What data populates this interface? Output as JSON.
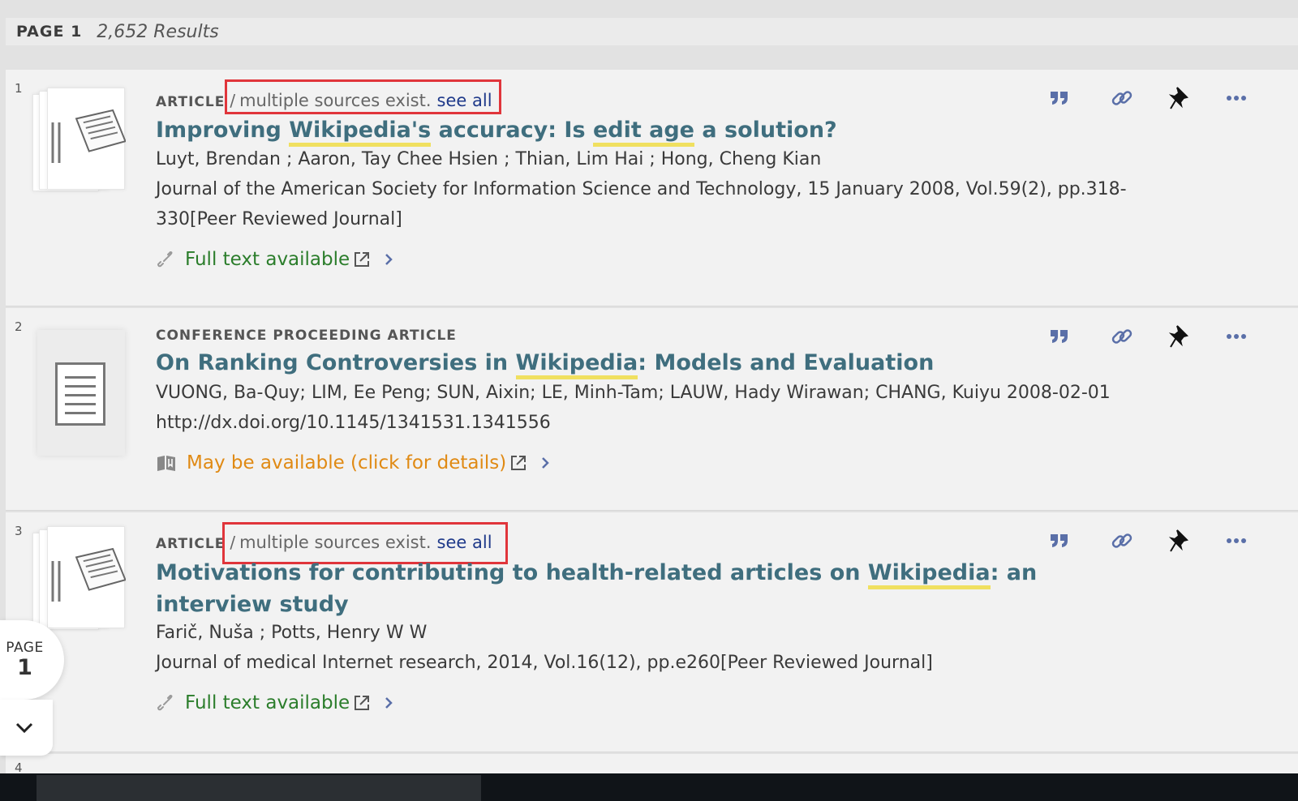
{
  "header": {
    "page_label": "PAGE 1",
    "results_count": "2,652 Results"
  },
  "results": [
    {
      "number": "1",
      "type": "ARTICLE",
      "multiple_sources": "multiple sources exist.",
      "see_all": "see all",
      "title": [
        "Improving ",
        "Wikipedia's",
        " accuracy: Is ",
        "edit age",
        " a solution?"
      ],
      "authors": "Luyt, Brendan ; Aaron, Tay Chee Hsien ; Thian, Lim Hai ; Hong, Cheng Kian",
      "source_line1": "Journal of the American Society for Information Science and Technology, 15 January 2008, Vol.59(2), pp.318-",
      "source_line2": "330[Peer Reviewed Journal]",
      "availability": "Full text available"
    },
    {
      "number": "2",
      "type": "CONFERENCE PROCEEDING ARTICLE",
      "title": [
        "On Ranking Controversies in ",
        "Wikipedia",
        ": Models and Evaluation"
      ],
      "authors": "VUONG, Ba-Quy; LIM, Ee Peng; SUN, Aixin; LE, Minh-Tam; LAUW, Hady Wirawan; CHANG, Kuiyu 2008-02-01",
      "doi": "http://dx.doi.org/10.1145/1341531.1341556",
      "availability": "May be available (click for details)"
    },
    {
      "number": "3",
      "type": "ARTICLE",
      "multiple_sources": "multiple sources exist.",
      "see_all": "see all",
      "title_line1": [
        "Motivations for contributing to health-related articles on ",
        "Wikipedia",
        ": an"
      ],
      "title_line2": "interview study",
      "authors": "Farič, Nuša ; Potts, Henry W W",
      "source_line1": "Journal of medical Internet research, 2014, Vol.16(12), pp.e260[Peer Reviewed Journal]",
      "availability": "Full text available"
    }
  ],
  "next_result_number": "4",
  "page_indicator": {
    "label": "PAGE",
    "number": "1"
  },
  "icons": [
    "quote-icon",
    "link-icon",
    "pin-icon",
    "more-icon",
    "external-link-icon",
    "chevron-right-icon",
    "chevron-down-icon"
  ],
  "colors": {
    "title": "#3f6e7e",
    "available": "#2b7d2b",
    "maybe_available": "#e08a14",
    "link": "#1f3a8a",
    "highlight": "#f0e060",
    "annotation_box": "#e0353b",
    "action_icon": "#5a6fa8"
  }
}
